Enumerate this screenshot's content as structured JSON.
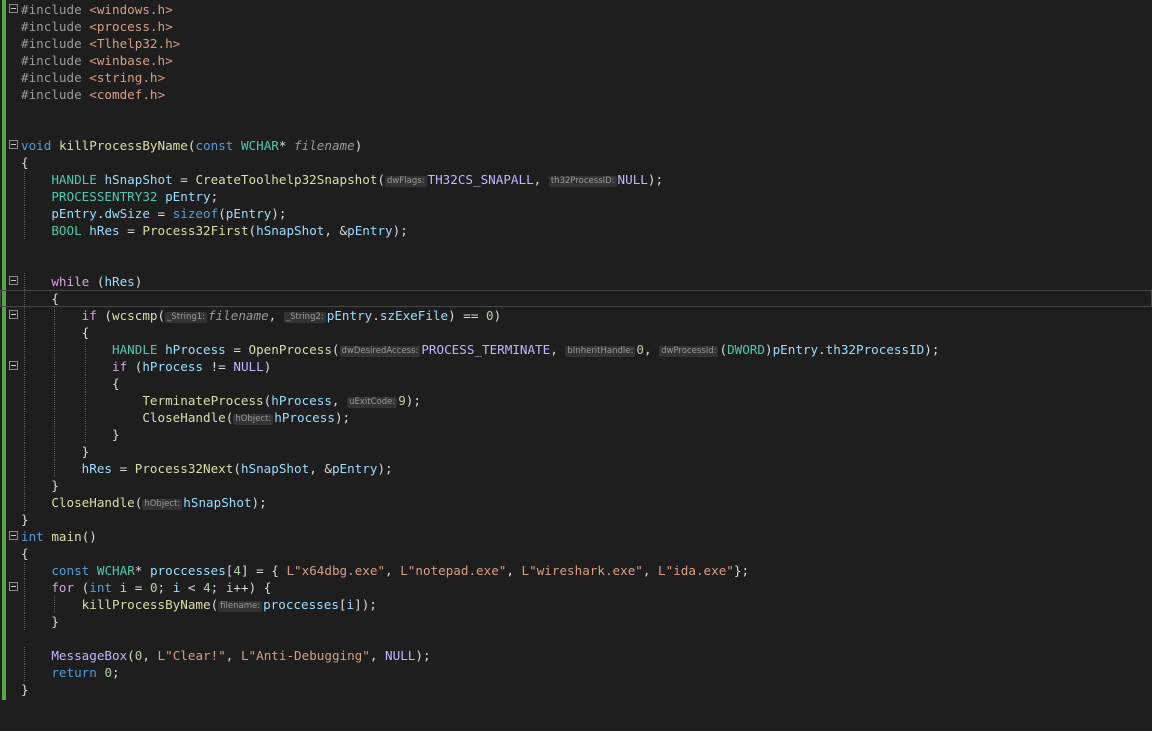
{
  "editor": {
    "colors": {
      "background": "#1e1e1e",
      "keyword": "#569cd6",
      "control": "#d8a0df",
      "function": "#dcdcaa",
      "type": "#4ec9b0",
      "string": "#d69d85",
      "number": "#b5cea8",
      "change_bar": "#57a64a"
    },
    "lines": [
      {
        "fold": true,
        "text": "#include <windows.h>"
      },
      {
        "text": "#include <process.h>"
      },
      {
        "text": "#include <Tlhelp32.h>"
      },
      {
        "text": "#include <winbase.h>"
      },
      {
        "text": "#include <string.h>"
      },
      {
        "text": "#include <comdef.h>"
      },
      {
        "text": ""
      },
      {
        "text": ""
      },
      {
        "fold": true,
        "text": "void killProcessByName(const WCHAR* filename)"
      },
      {
        "text": "{"
      },
      {
        "text": "    HANDLE hSnapShot = CreateToolhelp32Snapshot(dwFlags:TH32CS_SNAPALL, th32ProcessID:NULL);"
      },
      {
        "text": "    PROCESSENTRY32 pEntry;"
      },
      {
        "text": "    pEntry.dwSize = sizeof(pEntry);"
      },
      {
        "text": "    BOOL hRes = Process32First(hSnapShot, &pEntry);"
      },
      {
        "text": ""
      },
      {
        "text": ""
      },
      {
        "fold": true,
        "text": "    while (hRes)"
      },
      {
        "current": true,
        "text": "    {"
      },
      {
        "fold": true,
        "text": "        if (wcscmp(_String1:filename, _String2:pEntry.szExeFile) == 0)"
      },
      {
        "text": "        {"
      },
      {
        "text": "            HANDLE hProcess = OpenProcess(dwDesiredAccess:PROCESS_TERMINATE, bInheritHandle:0, dwProcessId:(DWORD)pEntry.th32ProcessID);"
      },
      {
        "fold": true,
        "text": "            if (hProcess != NULL)"
      },
      {
        "text": "            {"
      },
      {
        "text": "                TerminateProcess(hProcess, uExitCode:9);"
      },
      {
        "text": "                CloseHandle(hObject:hProcess);"
      },
      {
        "text": "            }"
      },
      {
        "text": "        }"
      },
      {
        "text": "        hRes = Process32Next(hSnapShot, &pEntry);"
      },
      {
        "text": "    }"
      },
      {
        "text": "    CloseHandle(hObject:hSnapShot);"
      },
      {
        "text": "}"
      },
      {
        "fold": true,
        "text": "int main()"
      },
      {
        "text": "{"
      },
      {
        "text": "    const WCHAR* proccesses[4] = { L\"x64dbg.exe\", L\"notepad.exe\", L\"wireshark.exe\", L\"ida.exe\"};"
      },
      {
        "fold": true,
        "text": "    for (int i = 0; i < 4; i++) {"
      },
      {
        "text": "        killProcessByName(filename:proccesses[i]);"
      },
      {
        "text": "    }"
      },
      {
        "text": ""
      },
      {
        "text": "    MessageBox(0, L\"Clear!\", L\"Anti-Debugging\", NULL);"
      },
      {
        "text": "    return 0;"
      },
      {
        "text": "}"
      }
    ]
  }
}
